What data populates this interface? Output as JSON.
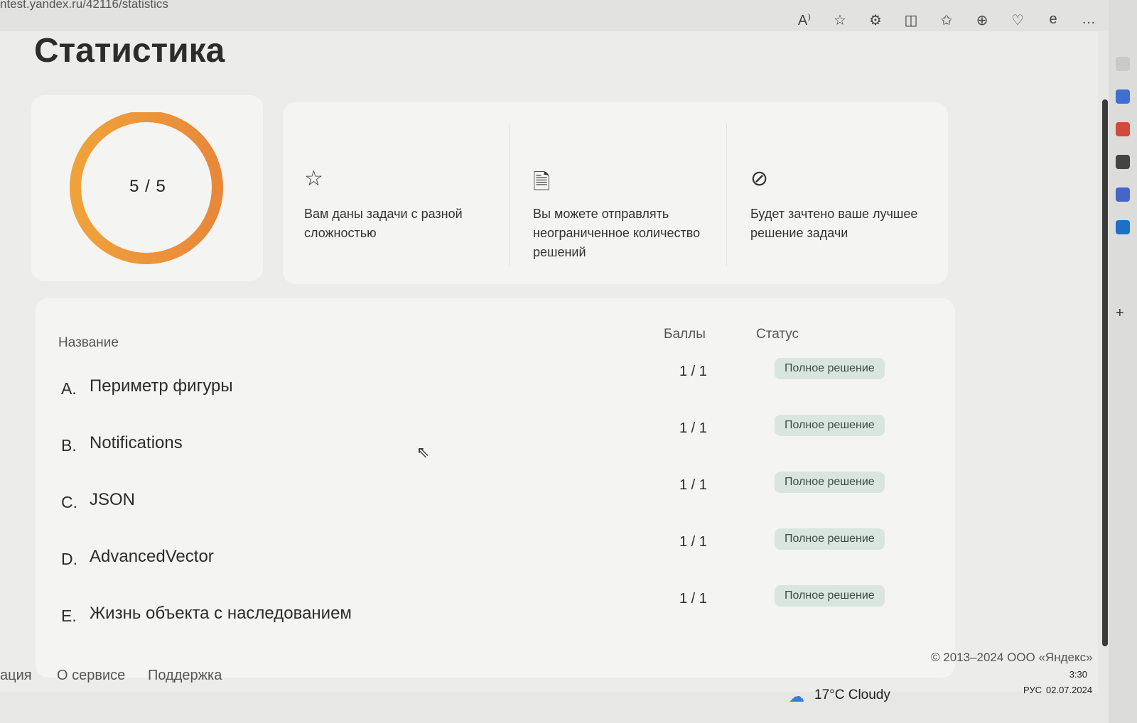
{
  "browser": {
    "url": "ntest.yandex.ru/42116/statistics",
    "toolbar": [
      "read-aloud-icon",
      "favorite-star-icon",
      "extensions-icon",
      "split-screen-icon",
      "favorites-icon",
      "collections-icon",
      "browser-essentials-icon",
      "edge-icon",
      "more-icon"
    ]
  },
  "page": {
    "title": "Статистика"
  },
  "progress": {
    "label": "5 / 5",
    "solved": 5,
    "total": 5,
    "ring_color_start": "#f0a23a",
    "ring_color_end": "#e8883a"
  },
  "chart_data": {
    "type": "pie",
    "values": [
      5
    ],
    "total": 5
  },
  "info": [
    {
      "icon": "star-icon",
      "text": "Вам даны задачи с разной сложностью"
    },
    {
      "icon": "document-send-icon",
      "text": "Вы можете отправлять неограниченное количество решений"
    },
    {
      "icon": "check-circle-icon",
      "text": "Будет зачтено ваше лучшее решение задачи"
    }
  ],
  "table": {
    "headers": {
      "name": "Название",
      "score": "Баллы",
      "status": "Статус"
    },
    "rows": [
      {
        "letter": "A.",
        "name": "Периметр фигуры",
        "score": "1 / 1",
        "status": "Полное решение"
      },
      {
        "letter": "B.",
        "name": "Notifications",
        "score": "1 / 1",
        "status": "Полное решение"
      },
      {
        "letter": "C.",
        "name": "JSON",
        "score": "1 / 1",
        "status": "Полное решение"
      },
      {
        "letter": "D.",
        "name": "AdvancedVector",
        "score": "1 / 1",
        "status": "Полное решение"
      },
      {
        "letter": "E.",
        "name": "Жизнь объекта с наследованием",
        "score": "1 / 1",
        "status": "Полное решение"
      }
    ]
  },
  "footer": {
    "copyright": "© 2013–2024 ООО «Яндекс»",
    "links": [
      "ация",
      "О сервисе",
      "Поддержка"
    ]
  },
  "taskbar": {
    "weather": "17°C  Cloudy",
    "language": "РУС",
    "time": "3:30",
    "date": "02.07.2024"
  }
}
